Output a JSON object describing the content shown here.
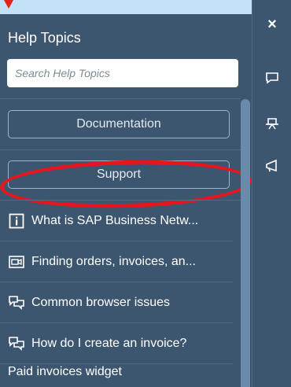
{
  "colors": {
    "panel_bg": "#3d5670",
    "highlight_ring": "#e8151f",
    "scrollbar": "#6a8aaa"
  },
  "panel": {
    "title": "Help Topics",
    "search": {
      "placeholder": "Search Help Topics",
      "value": ""
    },
    "buttons": {
      "documentation": "Documentation",
      "support": "Support"
    },
    "topics": [
      {
        "icon": "info-icon",
        "label": "What is SAP Business Netw..."
      },
      {
        "icon": "video-icon",
        "label": "Finding orders, invoices, an..."
      },
      {
        "icon": "chat-bubbles-icon",
        "label": "Common browser issues"
      },
      {
        "icon": "chat-bubbles-icon",
        "label": "How do I create an invoice?"
      },
      {
        "icon": "",
        "label": "Paid invoices widget"
      }
    ]
  },
  "rail": {
    "close": "×",
    "items": [
      "feedback-icon",
      "presentation-icon",
      "announcement-icon"
    ]
  }
}
